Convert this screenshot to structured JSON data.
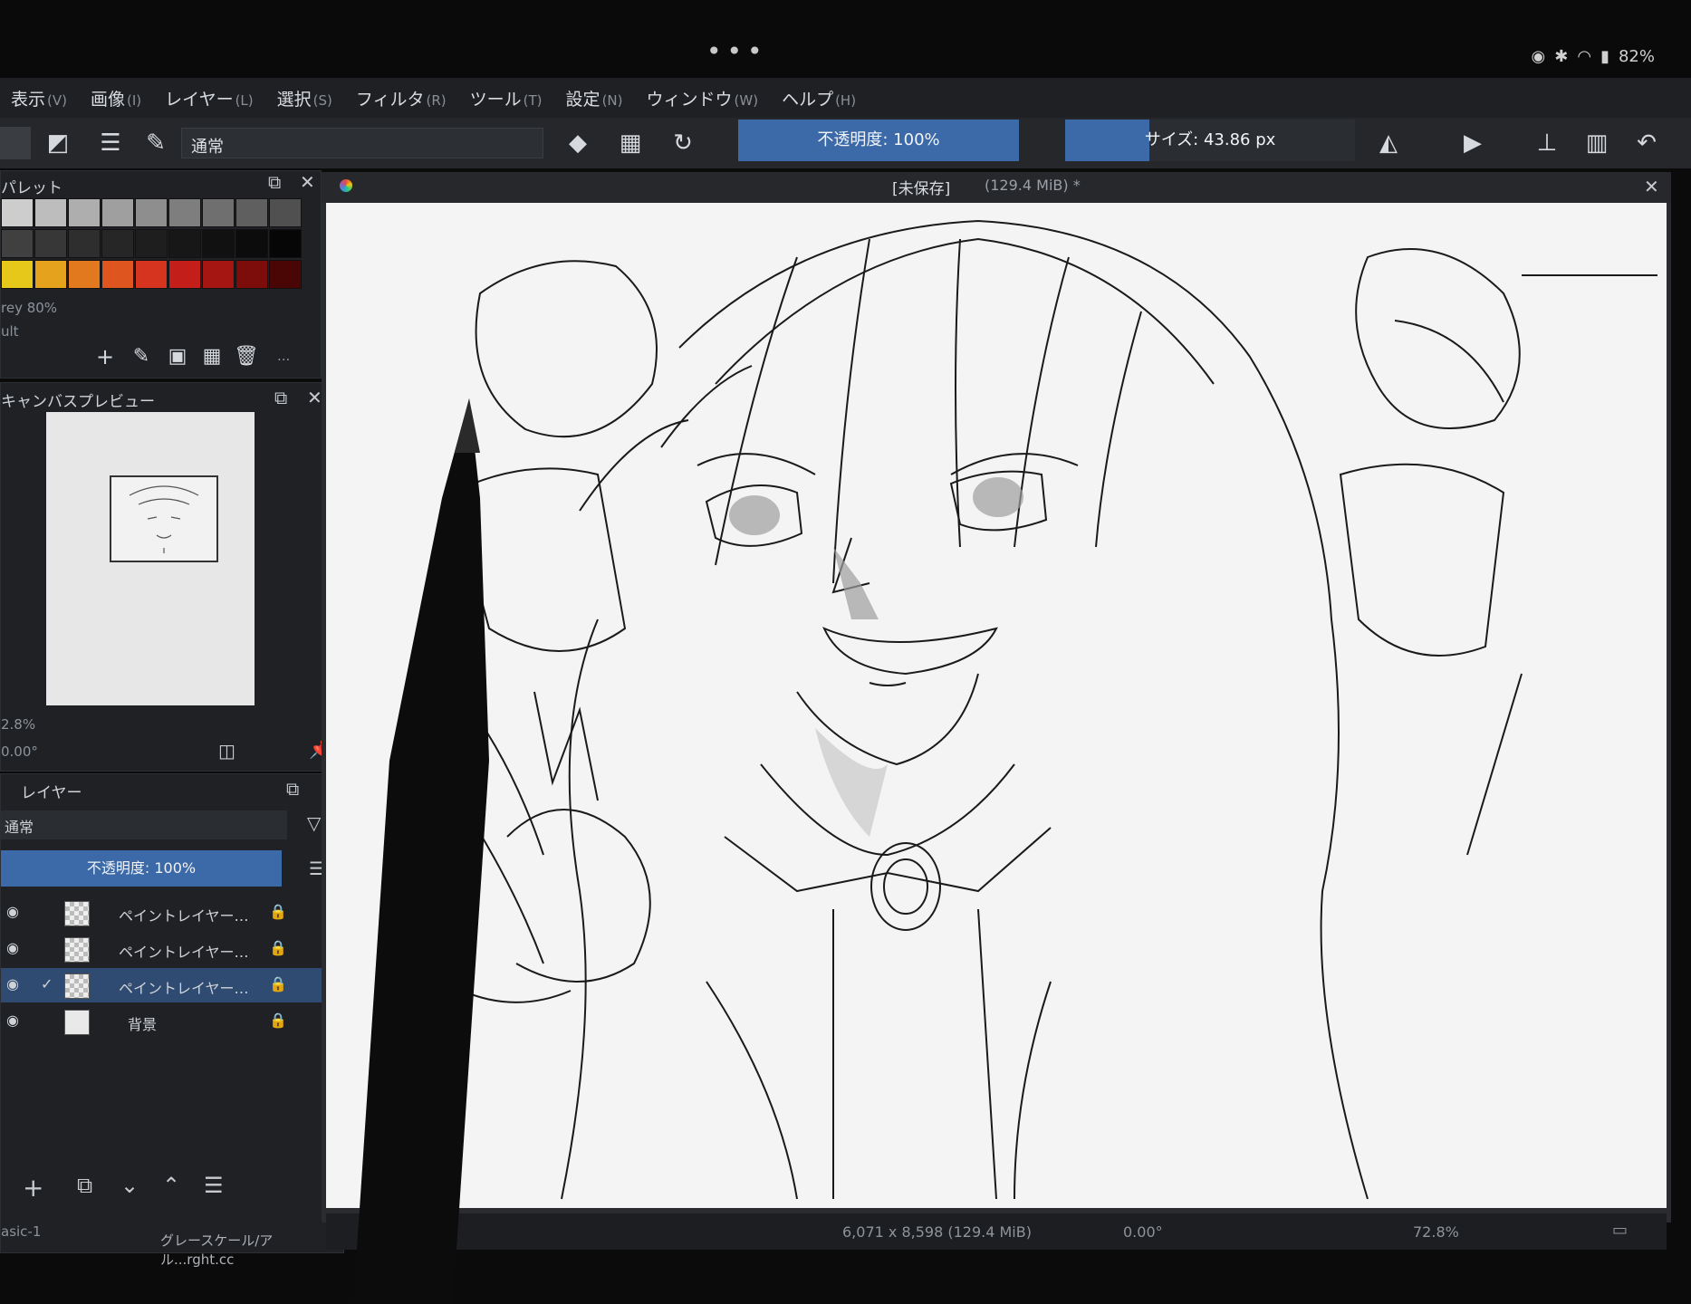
{
  "status": {
    "battery": "82%"
  },
  "menu": [
    {
      "label": "表示",
      "key": "(V)"
    },
    {
      "label": "画像",
      "key": "(I)"
    },
    {
      "label": "レイヤー",
      "key": "(L)"
    },
    {
      "label": "選択",
      "key": "(S)"
    },
    {
      "label": "フィルタ",
      "key": "(R)"
    },
    {
      "label": "ツール",
      "key": "(T)"
    },
    {
      "label": "設定",
      "key": "(N)"
    },
    {
      "label": "ウィンドウ",
      "key": "(W)"
    },
    {
      "label": "ヘルプ",
      "key": "(H)"
    }
  ],
  "toolbar": {
    "blend_mode": "通常",
    "opacity_label": "不透明度: 100%",
    "opacity_value": 100,
    "size_label": "サイズ: 43.86 px",
    "size_fill_fraction": 0.29
  },
  "palette": {
    "title": "パレット",
    "palette_name": "rey 80%",
    "palette_set": "ult",
    "more_label": "...",
    "row1": [
      "#cdcdcd",
      "#bdbdbd",
      "#aeaeae",
      "#9f9f9f",
      "#8e8e8e",
      "#7e7e7e",
      "#6f6f6f",
      "#5f5f5f",
      "#505050"
    ],
    "row2": [
      "#404040",
      "#373737",
      "#2e2e2e",
      "#262626",
      "#1e1e1e",
      "#171717",
      "#111111",
      "#0c0c0c",
      "#060606"
    ],
    "row3": [
      "#e6c81a",
      "#e5a21d",
      "#e2791f",
      "#de5520",
      "#d6341f",
      "#c41e1a",
      "#a51512",
      "#7d0d0b",
      "#4a0605"
    ]
  },
  "preview": {
    "title": "キャンバスプレビュー",
    "zoom": "2.8%",
    "rotation": "0.00°"
  },
  "layers": {
    "title": "レイヤー",
    "blend_mode": "通常",
    "opacity_label": "不透明度: 100%",
    "items": [
      {
        "name": "ペイントレイヤー…",
        "selected": false
      },
      {
        "name": "ペイントレイヤー…",
        "selected": false
      },
      {
        "name": "ペイントレイヤー…",
        "selected": true
      },
      {
        "name": "背景",
        "selected": false
      }
    ],
    "brush_preset": "asic-1",
    "color_model": "グレースケール/アル...rght.cc"
  },
  "document": {
    "tab_title": "[未保存]",
    "tab_size": "(129.4 MiB) *",
    "status_dims": "6,071 x 8,598 (129.4 MiB)",
    "status_rotation": "0.00°",
    "status_zoom": "72.8%"
  }
}
